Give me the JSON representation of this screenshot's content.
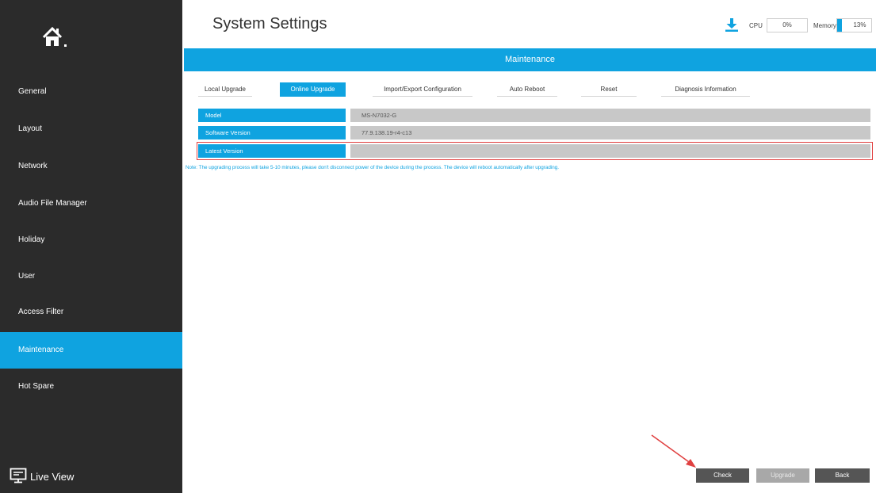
{
  "sidebar": {
    "items": [
      {
        "label": "General"
      },
      {
        "label": "Layout"
      },
      {
        "label": "Network"
      },
      {
        "label": "Audio File Manager"
      },
      {
        "label": "Holiday"
      },
      {
        "label": "User"
      },
      {
        "label": "Access Filter"
      },
      {
        "label": "Maintenance",
        "active": true
      },
      {
        "label": "Hot Spare"
      }
    ],
    "live_view": "Live View"
  },
  "header": {
    "title": "System Settings",
    "cpu_label": "CPU",
    "cpu_value": "0%",
    "memory_label": "Memory",
    "memory_value": "13%",
    "memory_fraction": 0.13
  },
  "main": {
    "section_title": "Maintenance",
    "tabs": [
      {
        "label": "Local Upgrade"
      },
      {
        "label": "Online Upgrade",
        "active": true
      },
      {
        "label": "Import/Export Configuration"
      },
      {
        "label": "Auto Reboot"
      },
      {
        "label": "Reset"
      },
      {
        "label": "Diagnosis Information"
      }
    ],
    "rows": [
      {
        "label": "Model",
        "value": "MS-N7032-G"
      },
      {
        "label": "Software Version",
        "value": "77.9.138.19-r4-c13"
      },
      {
        "label": "Latest Version",
        "value": ""
      }
    ],
    "note": "Note: The upgrading process will take 5-10 minutes, please don't disconnect power of the device during the process. The device will reboot automatically after upgrading."
  },
  "buttons": {
    "check": "Check",
    "upgrade": "Upgrade",
    "back": "Back"
  },
  "colors": {
    "accent": "#0fa3e0",
    "sidebar_bg": "#2b2b2b",
    "highlight": "#e04040"
  }
}
